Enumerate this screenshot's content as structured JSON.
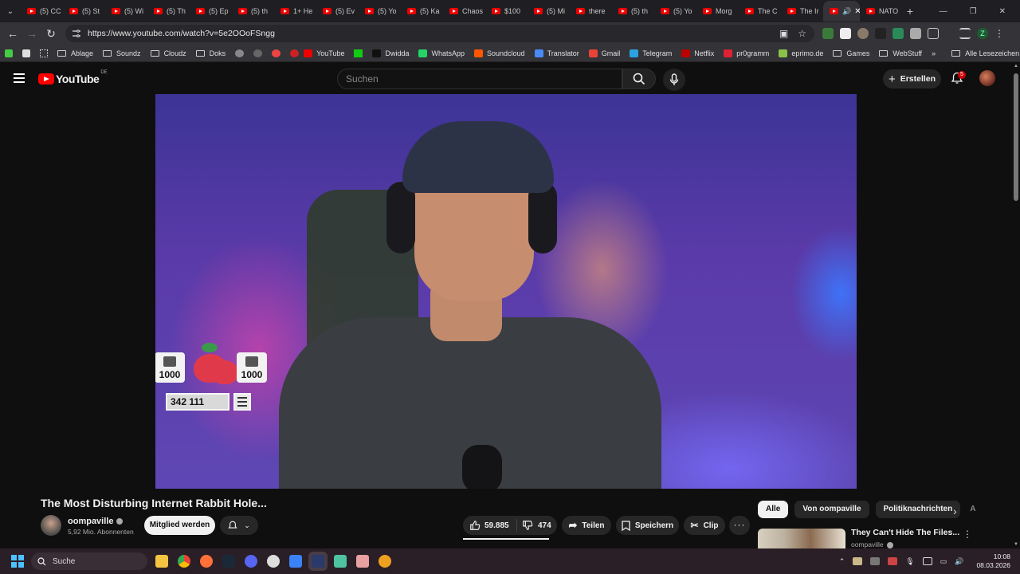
{
  "browser": {
    "tabs": [
      {
        "label": "(5) CC"
      },
      {
        "label": "(5) St"
      },
      {
        "label": "(5) Wi"
      },
      {
        "label": "(5) Th"
      },
      {
        "label": "(5) Ep"
      },
      {
        "label": "(5) th"
      },
      {
        "label": "1+ He"
      },
      {
        "label": "(5) Ev"
      },
      {
        "label": "(5) Yo"
      },
      {
        "label": "(5) Ka"
      },
      {
        "label": "Chaos"
      },
      {
        "label": "$100"
      },
      {
        "label": "(5) Mi"
      },
      {
        "label": "there"
      },
      {
        "label": "(5) th"
      },
      {
        "label": "(5) Yo"
      },
      {
        "label": "Morg"
      },
      {
        "label": "The C"
      },
      {
        "label": "The Ir"
      }
    ],
    "last_tab": "NATO",
    "url": "https://www.youtube.com/watch?v=5e2OOoFSngg",
    "bookmarks": [
      {
        "label": "Ablage",
        "icon": "folder"
      },
      {
        "label": "Soundz",
        "icon": "folder"
      },
      {
        "label": "Cloudz",
        "icon": "folder"
      },
      {
        "label": "Doks",
        "icon": "folder"
      },
      {
        "label": "YouTube",
        "icon": "youtube"
      },
      {
        "label": "Dwidda",
        "icon": "x"
      },
      {
        "label": "WhatsApp",
        "icon": "whatsapp"
      },
      {
        "label": "Soundcloud",
        "icon": "soundcloud"
      },
      {
        "label": "Translator",
        "icon": "translator"
      },
      {
        "label": "Gmail",
        "icon": "gmail"
      },
      {
        "label": "Telegram",
        "icon": "telegram"
      },
      {
        "label": "Netflix",
        "icon": "netflix"
      },
      {
        "label": "pr0gramm",
        "icon": "pr0gramm"
      },
      {
        "label": "eprimo.de",
        "icon": "eprimo"
      },
      {
        "label": "Games",
        "icon": "folder"
      },
      {
        "label": "WebStuff",
        "icon": "folder"
      }
    ],
    "all_bookmarks": "Alle Lesezeichen"
  },
  "youtube": {
    "logo_text": "YouTube",
    "country": "DE",
    "search_placeholder": "Suchen",
    "create_label": "Erstellen",
    "notif_count": "5",
    "video": {
      "title": "The Most Disturbing Internet Rabbit Hole...",
      "channel": "oompaville",
      "subscribers": "5,92 Mio. Abonnenten",
      "join_label": "Mitglied werden",
      "likes": "59.885",
      "dislikes": "474",
      "share_label": "Teilen",
      "save_label": "Speichern",
      "clip_label": "Clip",
      "overlay_counter": "342 111",
      "overlay_chip_left": "1000",
      "overlay_chip_right": "1000"
    },
    "chips": [
      "Alle",
      "Von oompaville",
      "Politiknachrichten",
      "A"
    ],
    "recommendation": {
      "title": "They Can't Hide The Files...",
      "channel": "oompaville"
    }
  },
  "taskbar": {
    "search_label": "Suche",
    "time": "10:08",
    "date": "08.03.2026"
  }
}
